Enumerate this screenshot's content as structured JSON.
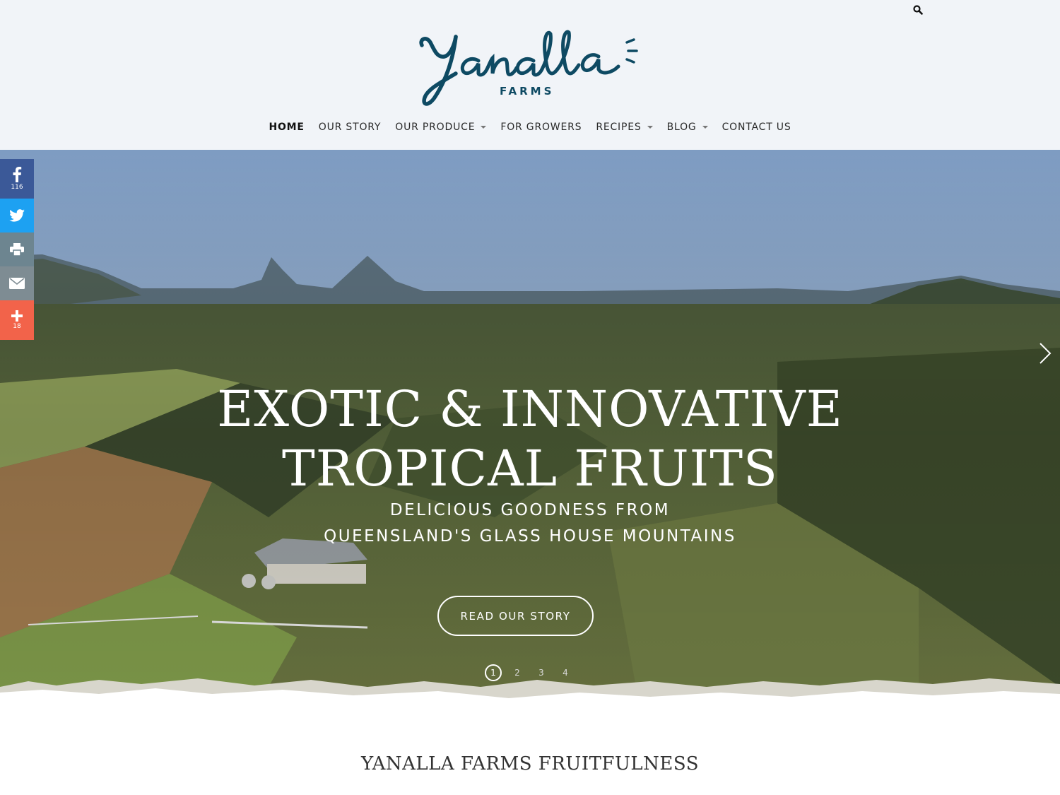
{
  "header": {
    "logo_script": "Yanalla",
    "logo_sub": "FARMS"
  },
  "nav": {
    "items": [
      {
        "label": "HOME",
        "active": true,
        "dropdown": false
      },
      {
        "label": "OUR STORY",
        "active": false,
        "dropdown": false
      },
      {
        "label": "OUR PRODUCE",
        "active": false,
        "dropdown": true
      },
      {
        "label": "FOR GROWERS",
        "active": false,
        "dropdown": false
      },
      {
        "label": "RECIPES",
        "active": false,
        "dropdown": true
      },
      {
        "label": "BLOG",
        "active": false,
        "dropdown": true
      },
      {
        "label": "CONTACT US",
        "active": false,
        "dropdown": false
      }
    ]
  },
  "hero": {
    "title_line1": "EXOTIC & INNOVATIVE",
    "title_line2": "TROPICAL FRUITS",
    "subtitle_line1": "DELICIOUS GOODNESS FROM",
    "subtitle_line2": "QUEENSLAND'S GLASS HOUSE MOUNTAINS",
    "button_label": "READ OUR STORY",
    "slides": [
      "1",
      "2",
      "3",
      "4"
    ],
    "active_slide": "1"
  },
  "social": {
    "facebook_count": "116",
    "more_count": "18",
    "icons": [
      "facebook-icon",
      "twitter-icon",
      "print-icon",
      "email-icon",
      "plus-icon"
    ]
  },
  "section": {
    "title": "YANALLA FARMS FRUITFULNESS"
  },
  "colors": {
    "header_bg": "#f1f4f8",
    "brand": "#0e4a63",
    "facebook": "#3b5998",
    "twitter": "#1da1f2",
    "print": "#6d8590",
    "email": "#7e8c93",
    "more": "#f2634a"
  }
}
